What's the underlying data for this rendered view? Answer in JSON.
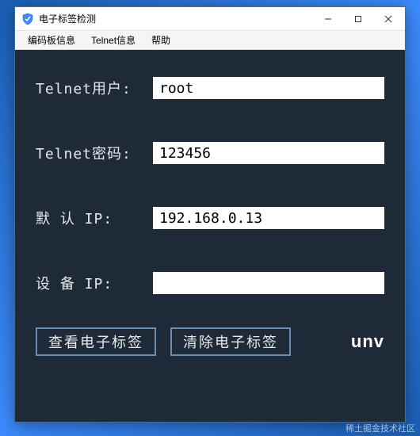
{
  "window": {
    "title": "电子标签检测"
  },
  "menu": {
    "encoding_board_info": "编码板信息",
    "telnet_info": "Telnet信息",
    "help": "帮助"
  },
  "form": {
    "telnet_user_label": "Telnet用户:",
    "telnet_user_value": "root",
    "telnet_pass_label": "Telnet密码:",
    "telnet_pass_value": "123456",
    "default_ip_label": "默 认 IP:",
    "default_ip_value": "192.168.0.13",
    "device_ip_label": "设 备 IP:",
    "device_ip_value": ""
  },
  "buttons": {
    "view_label": "查看电子标签",
    "clear_label": "清除电子标签"
  },
  "brand": {
    "logo_text": "unv"
  },
  "watermark": "稀土掘金技术社区"
}
